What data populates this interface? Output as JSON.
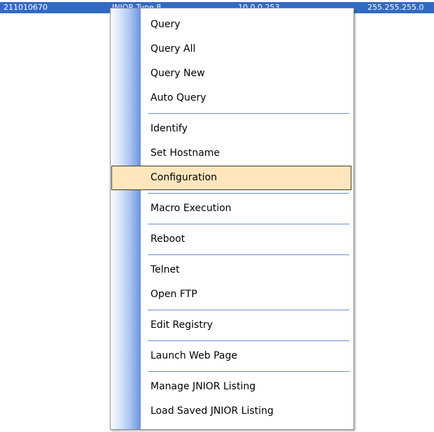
{
  "list_row": {
    "serial": "211010670",
    "model": "JNIOR Type 8...",
    "ip": "10.0.0.253",
    "mask": "255.255.255.0"
  },
  "context_menu": {
    "items": [
      {
        "label": "Query"
      },
      {
        "label": "Query All"
      },
      {
        "label": "Query New"
      },
      {
        "label": "Auto Query"
      },
      {
        "label": "Identify"
      },
      {
        "label": "Set Hostname"
      },
      {
        "label": "Configuration",
        "highlighted": true
      },
      {
        "label": "Macro Execution"
      },
      {
        "label": "Reboot"
      },
      {
        "label": "Telnet"
      },
      {
        "label": "Open FTP"
      },
      {
        "label": "Edit Registry"
      },
      {
        "label": "Launch Web Page"
      },
      {
        "label": "Manage JNIOR  Listing"
      },
      {
        "label": "Load Saved JNIOR Listing"
      }
    ]
  },
  "colors": {
    "selection_row": "#316ac5",
    "menu_highlight": "#ffe6bd",
    "separator": "#6b8fd1"
  }
}
